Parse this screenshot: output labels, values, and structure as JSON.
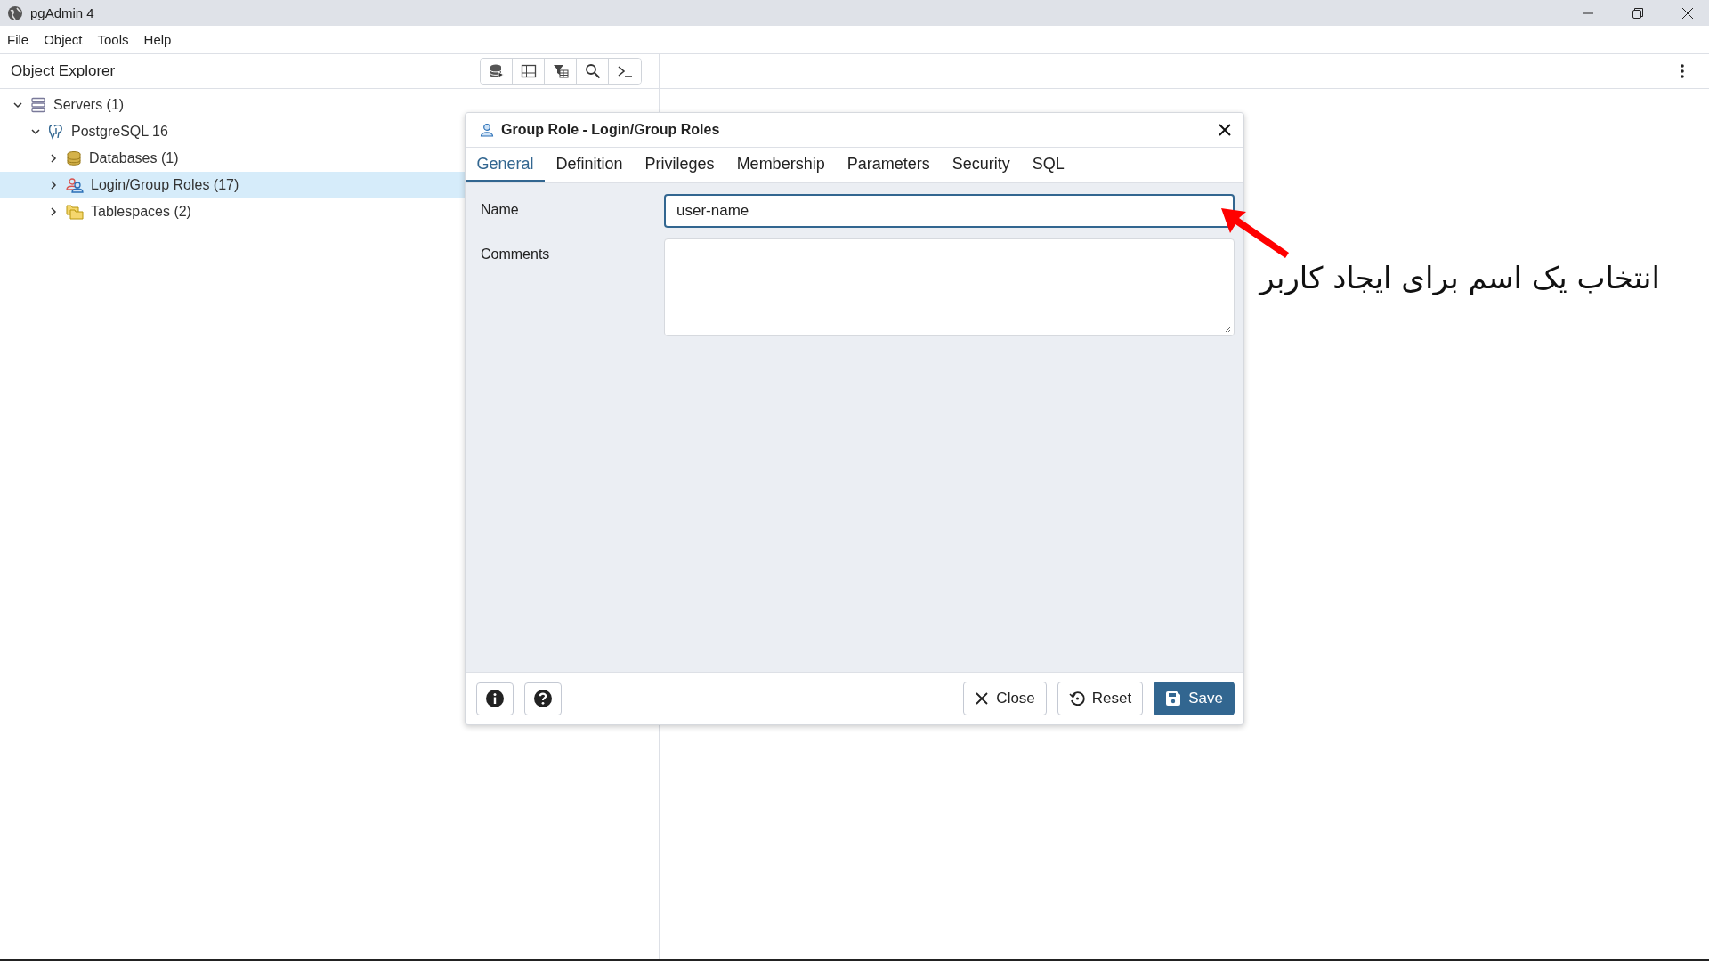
{
  "window": {
    "title": "pgAdmin 4"
  },
  "menu": [
    "File",
    "Object",
    "Tools",
    "Help"
  ],
  "object_explorer": {
    "title": "Object Explorer",
    "tree": [
      {
        "label": "Servers (1)",
        "kind": "servers",
        "expanded": true,
        "selected": false,
        "children": [
          {
            "label": "PostgreSQL 16",
            "kind": "server",
            "expanded": true,
            "selected": false,
            "children": [
              {
                "label": "Databases (1)",
                "kind": "databases",
                "expanded": false,
                "selected": false
              },
              {
                "label": "Login/Group Roles (17)",
                "kind": "roles",
                "expanded": false,
                "selected": true
              },
              {
                "label": "Tablespaces (2)",
                "kind": "tablespaces",
                "expanded": false,
                "selected": false
              }
            ]
          }
        ]
      }
    ]
  },
  "dialog": {
    "title": "Group Role - Login/Group Roles",
    "tabs": [
      {
        "label": "General",
        "selected": true
      },
      {
        "label": "Definition",
        "selected": false
      },
      {
        "label": "Privileges",
        "selected": false
      },
      {
        "label": "Membership",
        "selected": false
      },
      {
        "label": "Parameters",
        "selected": false
      },
      {
        "label": "Security",
        "selected": false
      },
      {
        "label": "SQL",
        "selected": false
      }
    ],
    "fields": [
      {
        "label": "Name",
        "kind": "text",
        "value": "user-name"
      },
      {
        "label": "Comments",
        "kind": "textarea"
      }
    ],
    "buttons": [
      {
        "label": "Close",
        "kind": "close"
      },
      {
        "label": "Reset",
        "kind": "reset"
      },
      {
        "label": "Save",
        "kind": "save"
      }
    ]
  },
  "annotation": {
    "text": "انتخاب یک اسم برای ایجاد کاربر"
  }
}
